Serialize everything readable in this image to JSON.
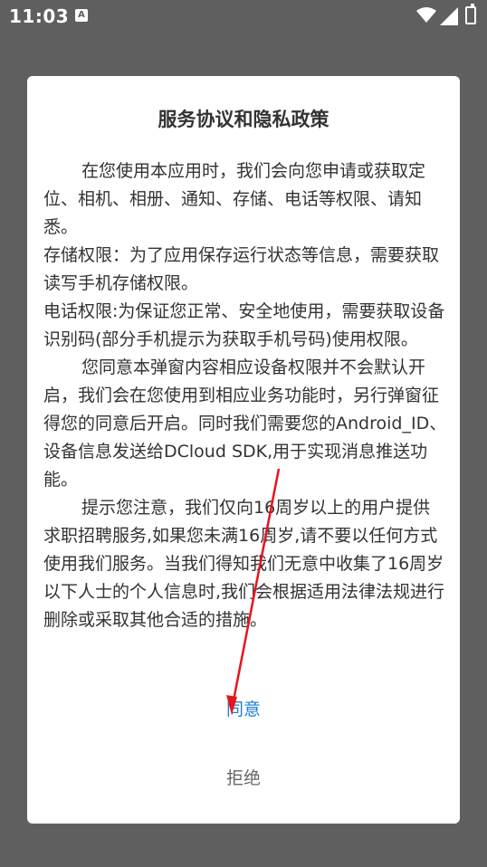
{
  "statusbar": {
    "time": "11:03",
    "notification_icon": "a-notification-icon",
    "icons": [
      "wifi-icon",
      "signal-icon",
      "battery-icon"
    ]
  },
  "dialog": {
    "title": "服务协议和隐私政策",
    "paragraphs": [
      "在您使用本应用时，我们会向您申请或获取定位、相机、相册、通知、存储、电话等权限、请知悉。",
      "存储权限：为了应用保存运行状态等信息，需要获取读写手机存储权限。",
      "电话权限:为保证您正常、安全地使用，需要获取设备识别码(部分手机提示为获取手机号码)使用权限。",
      "您同意本弹窗内容相应设备权限并不会默认开启，我们会在您使用到相应业务功能时，另行弹窗征得您的同意后开启。同时我们需要您的Android_ID、设备信息发送给DCloud SDK,用于实现消息推送功能。",
      "提示您注意，我们仅向16周岁以上的用户提供求职招聘服务,如果您未满16周岁,请不要以任何方式使用我们服务。当我们得知我们无意中收集了16周岁以下人士的个人信息时,我们会根据适用法律法规进行删除或采取其他合适的措施。"
    ],
    "agree_label": "同意",
    "reject_label": "拒绝"
  },
  "colors": {
    "overlay": "#5f5f5f",
    "accent": "#1a7fd6",
    "annotation_arrow": "#e8141c"
  }
}
